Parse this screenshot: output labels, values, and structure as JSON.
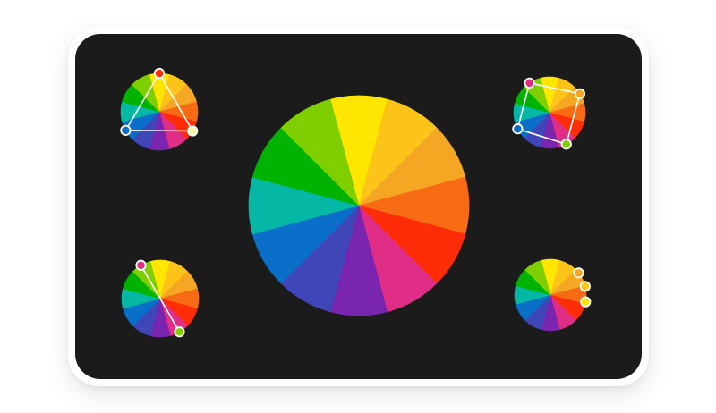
{
  "frame": {
    "background": "#1b1b1b",
    "bezel": "#ffffff"
  },
  "palette": [
    "#ffe600",
    "#fcc419",
    "#f5a623",
    "#f76b15",
    "#ff2d07",
    "#e02d86",
    "#7a25b0",
    "#3f47b8",
    "#0a6fc8",
    "#05b8a6",
    "#00b300",
    "#7fcf00"
  ],
  "wheels": [
    {
      "name": "main-color-wheel",
      "scheme": "full-spectrum"
    },
    {
      "name": "triadic-wheel",
      "scheme": "triadic",
      "markers": [
        {
          "color": "#ff2d07"
        },
        {
          "color": "#0a6fc8"
        },
        {
          "color": "#fff7a8"
        }
      ]
    },
    {
      "name": "tetradic-wheel",
      "scheme": "tetradic",
      "markers": [
        {
          "color": "#e02d86"
        },
        {
          "color": "#f5a623"
        },
        {
          "color": "#7fcf00"
        },
        {
          "color": "#0a6fc8"
        }
      ]
    },
    {
      "name": "complementary-wheel",
      "scheme": "complementary",
      "markers": [
        {
          "color": "#e02d86"
        },
        {
          "color": "#7fcf00"
        }
      ]
    },
    {
      "name": "analogous-wheel",
      "scheme": "analogous",
      "markers": [
        {
          "color": "#f5a623"
        },
        {
          "color": "#fcc419"
        },
        {
          "color": "#ffe600"
        }
      ]
    }
  ]
}
